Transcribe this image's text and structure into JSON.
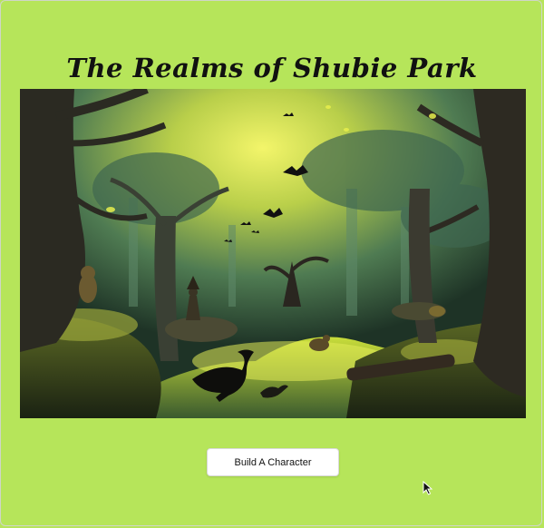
{
  "page": {
    "title": "The Realms of Shubie Park",
    "background_color": "#b6e55a"
  },
  "hero_image": {
    "subject": "enchanted swamp forest with birds, owls and a wandering wizard"
  },
  "actions": {
    "build_character_label": "Build A Character"
  },
  "pointer": {
    "icon": "mouse-pointer-icon"
  }
}
